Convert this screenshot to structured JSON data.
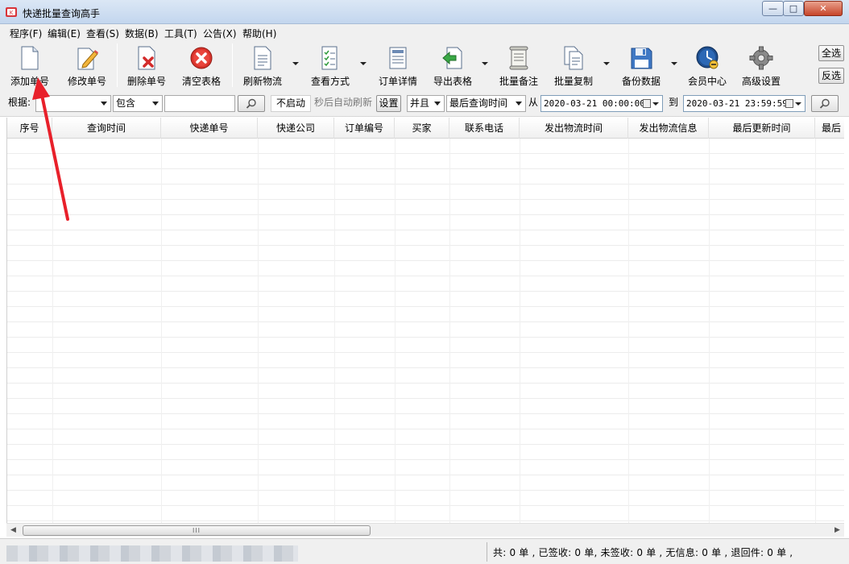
{
  "window": {
    "title": "快递批量查询高手",
    "controls": {
      "minimize": "—",
      "maximize": "□",
      "close": "✕"
    },
    "accent": "#c7452a"
  },
  "menu": [
    {
      "label": "程序(F)"
    },
    {
      "label": "编辑(E)"
    },
    {
      "label": "查看(S)"
    },
    {
      "label": "数据(B)"
    },
    {
      "label": "工具(T)"
    },
    {
      "label": "公告(X)"
    },
    {
      "label": "帮助(H)"
    }
  ],
  "toolbar": {
    "add": {
      "label": "添加单号",
      "icon": "add-document-icon"
    },
    "edit": {
      "label": "修改单号",
      "icon": "edit-document-icon"
    },
    "delete": {
      "label": "删除单号",
      "icon": "delete-document-icon"
    },
    "clear": {
      "label": "清空表格",
      "icon": "clear-table-icon"
    },
    "refresh": {
      "label": "刷新物流",
      "icon": "refresh-document-icon"
    },
    "view": {
      "label": "查看方式",
      "icon": "checklist-icon"
    },
    "detail": {
      "label": "订单详情",
      "icon": "order-detail-icon"
    },
    "export": {
      "label": "导出表格",
      "icon": "export-icon"
    },
    "note": {
      "label": "批量备注",
      "icon": "note-icon"
    },
    "copy": {
      "label": "批量复制",
      "icon": "copy-icon"
    },
    "backup": {
      "label": "备份数据",
      "icon": "floppy-disk-icon"
    },
    "member": {
      "label": "会员中心",
      "icon": "clock-icon"
    },
    "settings": {
      "label": "高级设置",
      "icon": "gear-icon"
    },
    "select_all": "全选",
    "invert_select": "反选"
  },
  "filter": {
    "basis_label": "根据:",
    "basis_value": "",
    "match_value": "包含",
    "keyword_value": "",
    "auto_refresh_state": "不启动",
    "auto_refresh_text": "秒后自动刷新",
    "settings_button": "设置",
    "logic_value": "并且",
    "time_field_value": "最后查询时间",
    "from_label": "从",
    "from_date": "2020-03-21 00:00:00",
    "to_label": "到",
    "to_date": "2020-03-21 23:59:59"
  },
  "table": {
    "columns": [
      "序号",
      "查询时间",
      "快递单号",
      "快递公司",
      "订单编号",
      "买家",
      "联系电话",
      "发出物流时间",
      "发出物流信息",
      "最后更新时间",
      "最后"
    ]
  },
  "scrollbar": {
    "grip": "III"
  },
  "status": {
    "summary": "共: 0 单 , 已签收:  0 单, 未签收:  0 单 , 无信息: 0 单 , 退回件: 0 单 ,"
  }
}
